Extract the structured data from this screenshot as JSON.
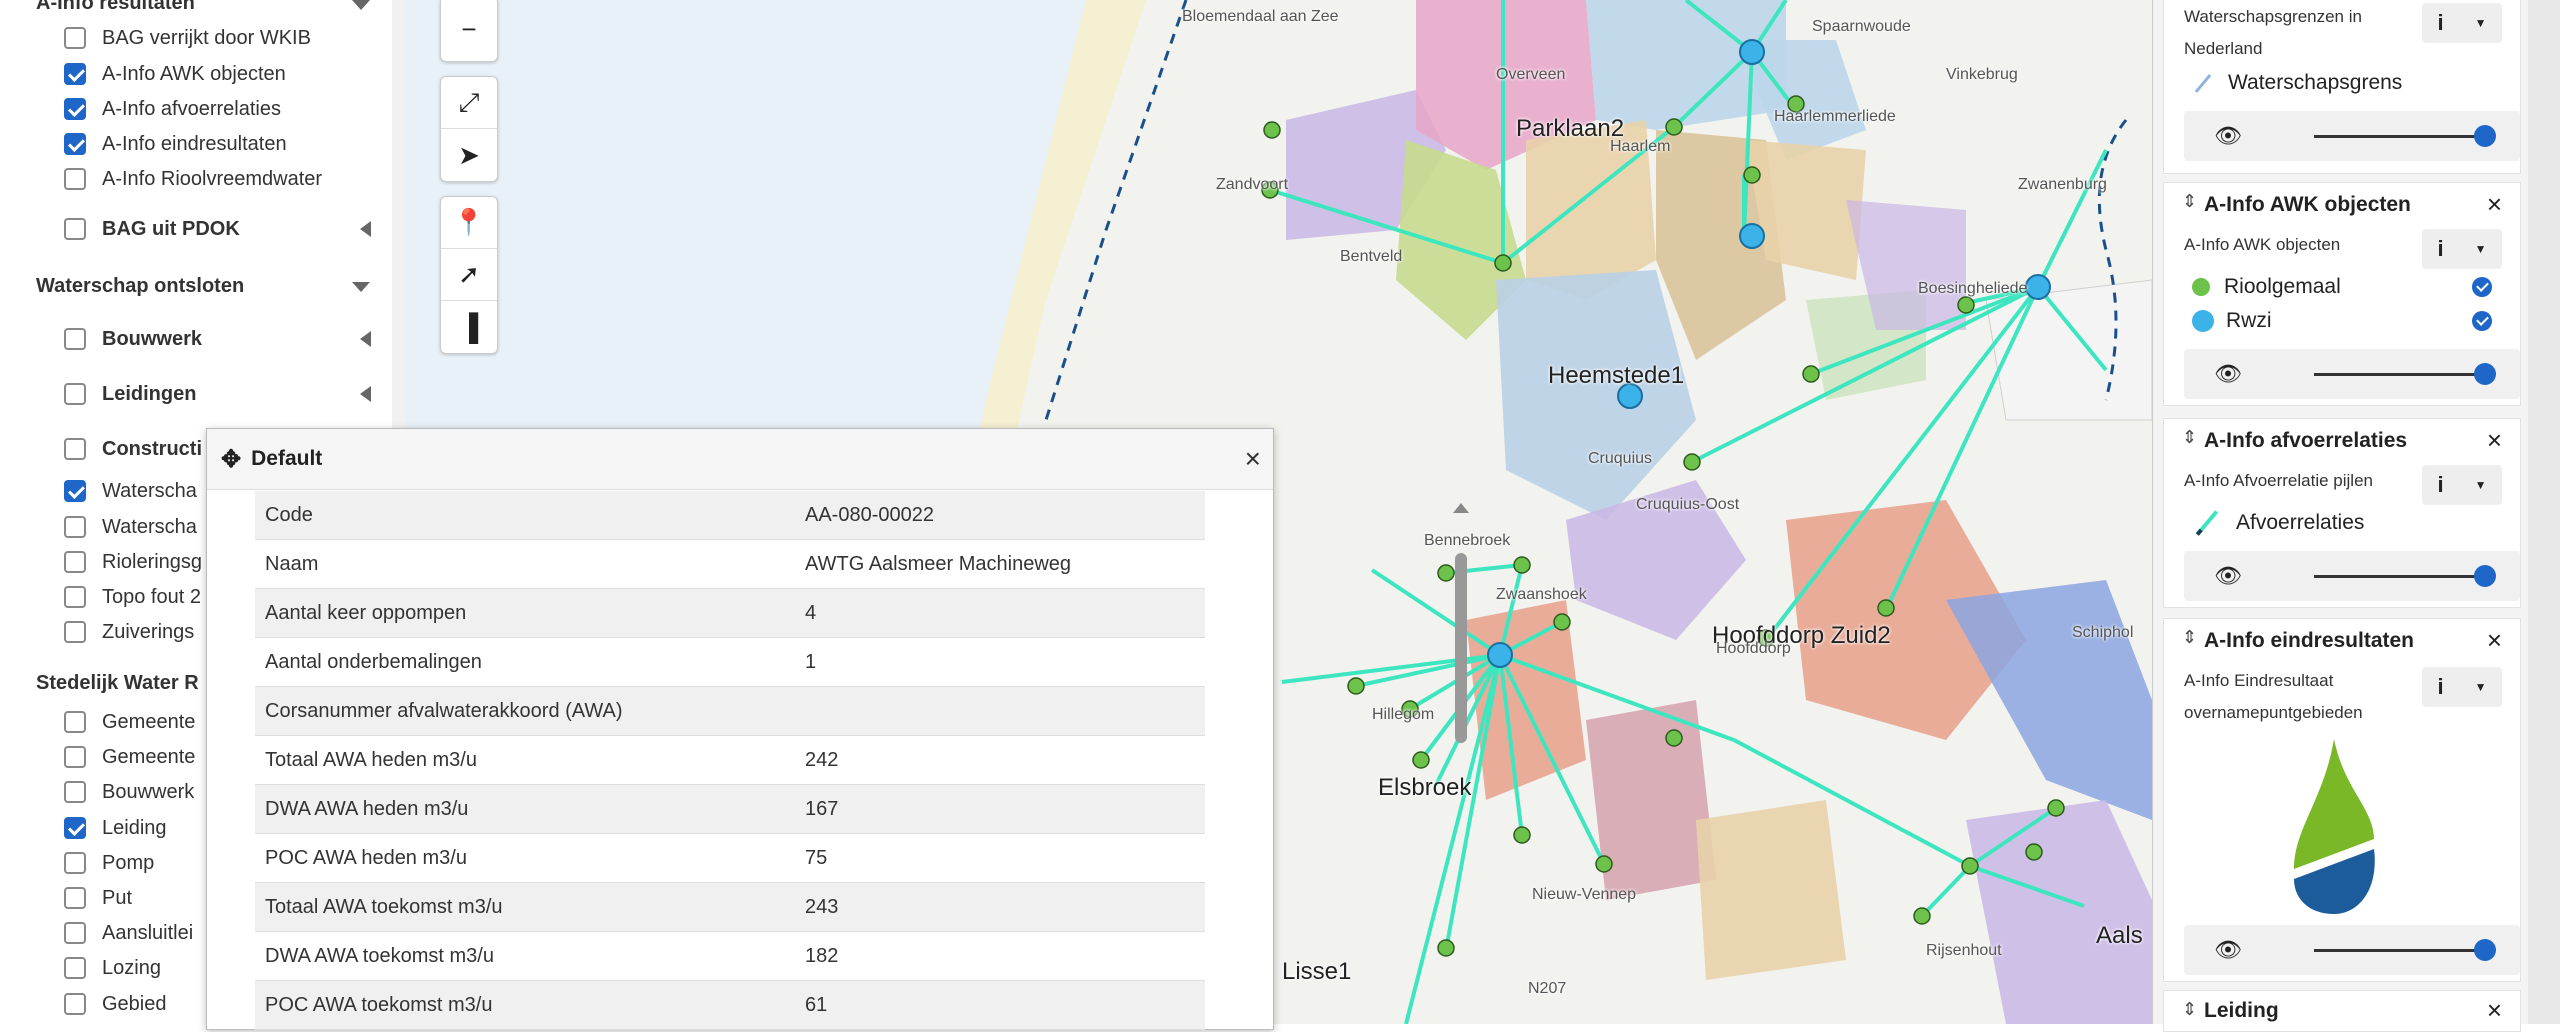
{
  "layer_tree": {
    "groups": {
      "ainfo": "A-Info resultaten",
      "waterschap": "Waterschap ontsloten",
      "stedelijk": "Stedelijk Water R"
    },
    "ainfo_items": [
      {
        "label": "BAG verrijkt door WKIB",
        "checked": false
      },
      {
        "label": "A-Info AWK objecten",
        "checked": true
      },
      {
        "label": "A-Info afvoerrelaties",
        "checked": true
      },
      {
        "label": "A-Info eindresultaten",
        "checked": true
      },
      {
        "label": "A-Info Rioolvreemdwater",
        "checked": false
      }
    ],
    "bag_pdok": "BAG uit PDOK",
    "waterschap_items": [
      {
        "label": "Bouwwerk",
        "checked": false
      },
      {
        "label": "Leidingen",
        "checked": false
      },
      {
        "label": "Constructi",
        "checked": false
      },
      {
        "label": "Waterscha",
        "checked": true
      },
      {
        "label": "Waterscha",
        "checked": false
      },
      {
        "label": "Rioleringsg",
        "checked": false
      },
      {
        "label": "Topo fout 2",
        "checked": false
      },
      {
        "label": "Zuiverings",
        "checked": false
      }
    ],
    "stedelijk_items": [
      {
        "label": "Gemeente",
        "checked": false
      },
      {
        "label": "Gemeente",
        "checked": false
      },
      {
        "label": "Bouwwerk",
        "checked": false
      },
      {
        "label": "Leiding",
        "checked": true
      },
      {
        "label": "Pomp",
        "checked": false
      },
      {
        "label": "Put",
        "checked": false
      },
      {
        "label": "Aansluitlei",
        "checked": false
      },
      {
        "label": "Lozing",
        "checked": false
      },
      {
        "label": "Gebied",
        "checked": false
      }
    ]
  },
  "map": {
    "toolbar_icons": [
      "zoom-out-icon",
      "fullscreen-icon",
      "locate-icon",
      "pin-icon",
      "select-icon",
      "measure-icon"
    ],
    "labels": {
      "parklaan": "Parklaan2",
      "heemstede": "Heemstede1",
      "hoofddorp": "Hoofddorp Zuid2",
      "hoofddorp_sm": "Hoofddorp",
      "elsbroek": "Elsbroek",
      "lisse": "Lisse1",
      "aals": "Aals",
      "bloemendaal": "Bloemendaal aan Zee",
      "overveen": "Overveen",
      "zandvoort": "Zandvoort",
      "bentveld": "Bentveld",
      "haarlem": "Haarlem",
      "spaarndam": "Spaarnwoude",
      "vinkebrug": "Vinkebrug",
      "haarlemmerliede": "Haarlemmerliede",
      "zwanenburg": "Zwanenburg",
      "boesingheliede": "Boesingheliede",
      "cruquius": "Cruquius",
      "cruquius_oost": "Cruquius-Oost",
      "bennebroek": "Bennebroek",
      "zwaanshoek": "Zwaanshoek",
      "hillegom": "Hillegom",
      "nieuw_vennep": "Nieuw-Vennep",
      "rijsenhout": "Rijsenhout",
      "schiphol": "Schiphol",
      "n207": "N207"
    }
  },
  "popup": {
    "title": "Default",
    "rows": [
      {
        "key": "Code",
        "value": "AA-080-00022"
      },
      {
        "key": "Naam",
        "value": "AWTG Aalsmeer Machineweg"
      },
      {
        "key": "Aantal keer oppompen",
        "value": "4"
      },
      {
        "key": "Aantal onderbemalingen",
        "value": "1"
      },
      {
        "key": "Corsanummer afvalwaterakkoord (AWA)",
        "value": ""
      },
      {
        "key": "Totaal AWA heden m3/u",
        "value": "242"
      },
      {
        "key": "DWA AWA heden m3/u",
        "value": "167"
      },
      {
        "key": "POC AWA heden m3/u",
        "value": "75"
      },
      {
        "key": "Totaal AWA toekomst m3/u",
        "value": "243"
      },
      {
        "key": "DWA AWA toekomst m3/u",
        "value": "182"
      },
      {
        "key": "POC AWA toekomst m3/u",
        "value": "61"
      }
    ]
  },
  "legend": {
    "waterschap": {
      "sub": "Waterschapsgrenzen in Nederland",
      "item": "Waterschapsgrens"
    },
    "awk": {
      "title": "A-Info AWK objecten",
      "sub": "A-Info AWK objecten",
      "items": [
        "Rioolgemaal",
        "Rwzi"
      ]
    },
    "afvoer": {
      "title": "A-Info afvoerrelaties",
      "sub": "A-Info Afvoerrelatie pijlen",
      "item": "Afvoerrelaties"
    },
    "eind": {
      "title": "A-Info eindresultaten",
      "sub1": "A-Info Eindresultaat",
      "sub2": "overnamepuntgebieden"
    },
    "leiding": {
      "title": "Leiding"
    },
    "info_label": "i",
    "close": "×",
    "colors": {
      "rioolgemaal": "#6cc24a",
      "rwzi": "#3bb3e9",
      "accent": "#1e66c7",
      "relation": "#3ee6c0"
    }
  }
}
